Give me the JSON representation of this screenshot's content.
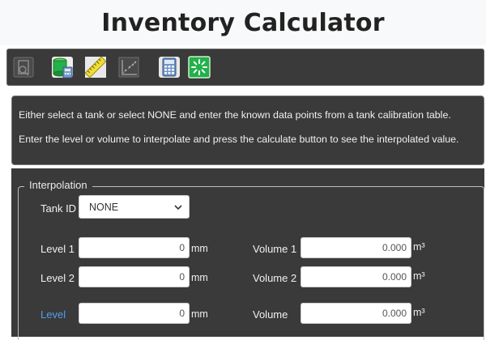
{
  "app": {
    "title": "Inventory Calculator"
  },
  "toolbar": {
    "tools": [
      {
        "icon": "report-icon",
        "enabled": false
      },
      {
        "icon": "tank-calculator-icon",
        "enabled": true
      },
      {
        "icon": "ruler-icon",
        "enabled": true
      },
      {
        "icon": "scatter-chart-icon",
        "enabled": false
      },
      {
        "icon": "calculator-icon",
        "enabled": true
      },
      {
        "icon": "loading-icon",
        "enabled": true
      }
    ]
  },
  "info": {
    "line1": "Either select a tank or select NONE and enter the known data points from a tank calibration table.",
    "line2": "Enter the level or volume to interpolate and press the calculate button to see the interpolated value."
  },
  "interpolation": {
    "legend": "Interpolation",
    "tank_id_label": "Tank ID",
    "tank_id_value": "NONE",
    "level1_label": "Level 1",
    "level1_value": "0",
    "level2_label": "Level 2",
    "level2_value": "0",
    "level_label": "Level",
    "level_value": "0",
    "level_unit": "mm",
    "volume1_label": "Volume 1",
    "volume1_value": "0.000",
    "volume2_label": "Volume 2",
    "volume2_value": "0.000",
    "volume_label": "Volume",
    "volume_value": "0.000",
    "volume_unit": "m³"
  },
  "colors": {
    "panel_bg": "#3a3a3a",
    "link": "#4d9ff0",
    "accent_green": "#22b14c"
  }
}
